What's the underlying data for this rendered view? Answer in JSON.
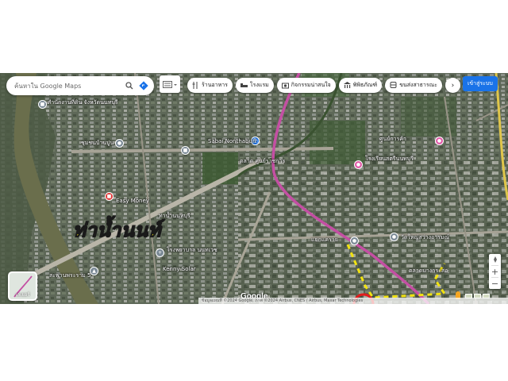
{
  "map": {
    "provider_logo": "Google",
    "attribution": "ข้อมูลแผนที่ ©2024 Google, ภาพ ©2024 Airbus, CNES / Airbus, Maxar Technologies",
    "colors": {
      "satellite_base": "#5b6554",
      "rail_line": "#c44fa3",
      "dashed_boundary": "#f2e311",
      "highlight_circle": "#e21d1d",
      "river": "#6a6e4c",
      "label_yellow": "#f2e311",
      "signin_blue": "#1a73e8"
    }
  },
  "search": {
    "placeholder": "ค้นหาใน Google Maps",
    "search_icon": "search-icon",
    "directions_icon": "directions-icon"
  },
  "layer_toggle": {
    "icon": "keyboard-icon"
  },
  "chips": [
    {
      "label": "ร้านอาหาร",
      "icon": "restaurant-icon"
    },
    {
      "label": "โรงแรม",
      "icon": "hotel-icon"
    },
    {
      "label": "กิจกรรมน่าสนใจ",
      "icon": "camera-icon"
    },
    {
      "label": "พิพิธภัณฑ์",
      "icon": "museum-icon"
    },
    {
      "label": "ขนส่งสาธารณะ",
      "icon": "transit-icon"
    }
  ],
  "chips_more_icon": "chevron-right-icon",
  "header_right": {
    "apps_icon": "apps-grid-icon",
    "signin_label": "เข้าสู่ระบบ"
  },
  "annotation": {
    "big_label": "ท่าน้ำนนท์"
  },
  "places": [
    {
      "name": "สำนักงานที่ดิน จังหวัดนนทบุรี",
      "type": "government"
    },
    {
      "name": "ชุมชนบ้านปูน",
      "type": "place"
    },
    {
      "name": "Sabai Nonthaburi",
      "type": "shopping"
    },
    {
      "name": "ตลาด ศูนย์ราชการ",
      "type": "shopping"
    },
    {
      "name": "โรงเรียนสตรีนนทบุรี",
      "type": "school"
    },
    {
      "name": "Easy Money",
      "type": "business"
    },
    {
      "name": "สะพานพระราม 5",
      "type": "landmark"
    },
    {
      "name": "ท่าน้ำนนทบุรี",
      "type": "pier"
    },
    {
      "name": "โรงพยาบาล นนทเวช",
      "type": "hospital"
    },
    {
      "name": "Kenny Solar",
      "type": "business"
    },
    {
      "name": "แยกแคราย",
      "type": "intersection"
    },
    {
      "name": "วัดใหญ่สว่างอารมณ์",
      "type": "temple"
    },
    {
      "name": "ตลาดบางกระสอ",
      "type": "market"
    },
    {
      "name": "ศูนย์การค้า",
      "type": "shopping"
    }
  ],
  "controls": {
    "layers_label": "เลเยอร์",
    "zoom_in": "+",
    "zoom_out": "−",
    "compass_icon": "compass-icon"
  }
}
